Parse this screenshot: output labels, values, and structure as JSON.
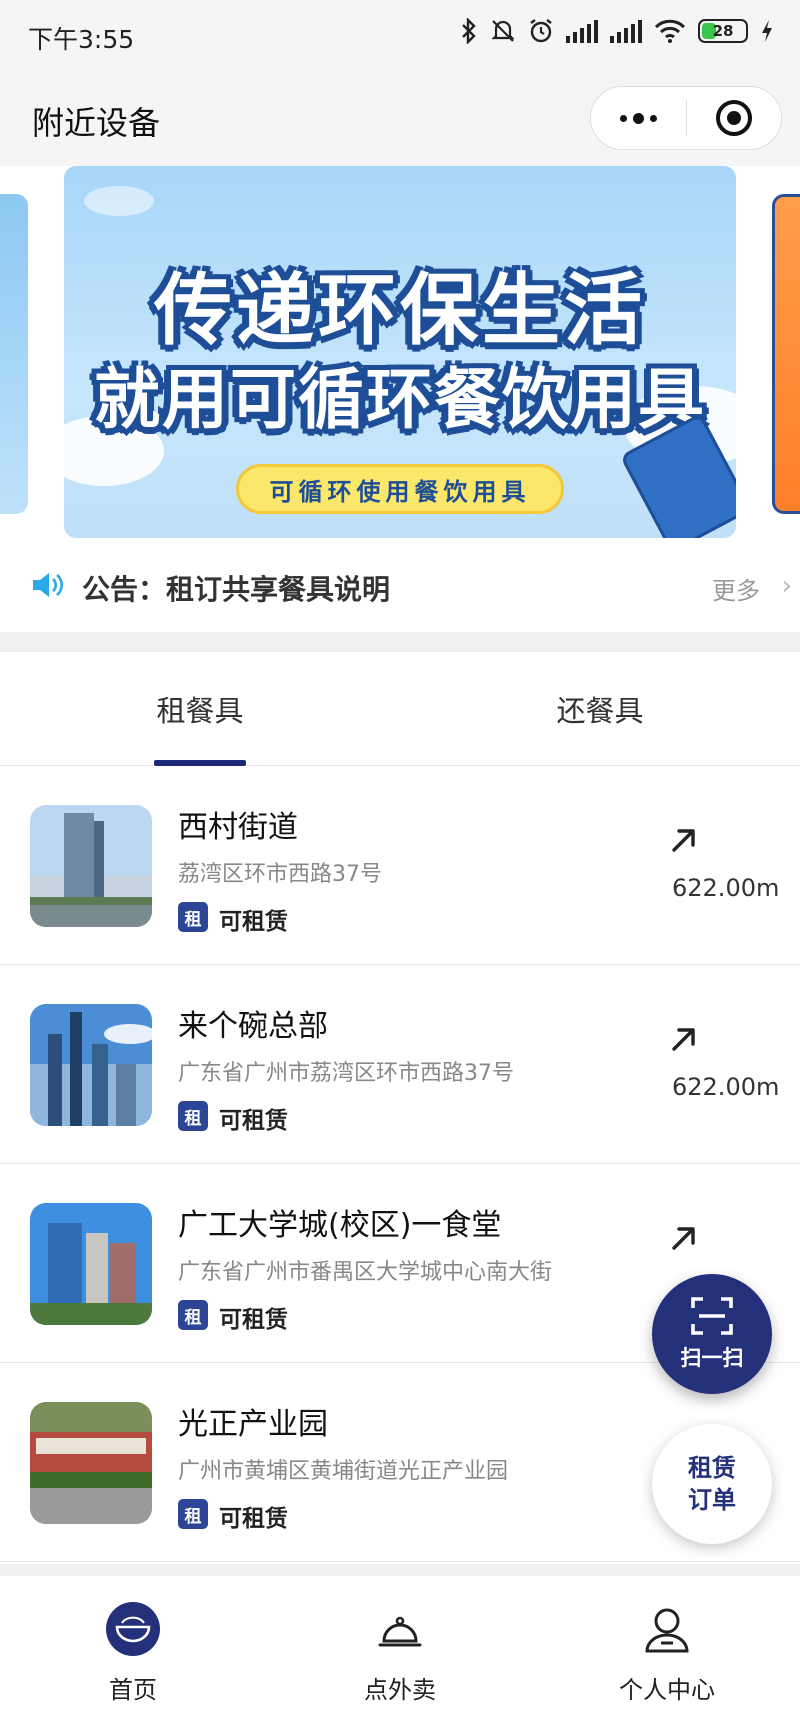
{
  "status_bar": {
    "time": "下午3:55",
    "battery": "28"
  },
  "header": {
    "title": "附近设备"
  },
  "banner": {
    "line1": "传递环保生活",
    "line2": "就用可循环餐饮用具",
    "pill": "可循环使用餐饮用具"
  },
  "notice": {
    "text": "公告：租订共享餐具说明",
    "more": "更多"
  },
  "tabs": [
    {
      "label": "租餐具",
      "active": true
    },
    {
      "label": "还餐具",
      "active": false
    }
  ],
  "locations": [
    {
      "name": "西村街道",
      "address": "荔湾区环市西路37号",
      "badge": "租",
      "status": "可租赁",
      "distance": "622.00m"
    },
    {
      "name": "来个碗总部",
      "address": "广东省广州市荔湾区环市西路37号",
      "badge": "租",
      "status": "可租赁",
      "distance": "622.00m"
    },
    {
      "name": "广工大学城(校区)一食堂",
      "address": "广东省广州市番禺区大学城中心南大街",
      "badge": "租",
      "status": "可租赁",
      "distance": ""
    },
    {
      "name": "光正产业园",
      "address": "广州市黄埔区黄埔街道光正产业园",
      "badge": "租",
      "status": "可租赁",
      "distance": ""
    }
  ],
  "fab": {
    "scan_label": "扫一扫",
    "order_label": "租赁订单"
  },
  "bottom_nav": [
    {
      "label": "首页",
      "icon": "home-logo-icon",
      "active": true
    },
    {
      "label": "点外卖",
      "icon": "bell-icon",
      "active": false
    },
    {
      "label": "个人中心",
      "icon": "user-icon",
      "active": false
    }
  ],
  "colors": {
    "accent": "#1e2a78",
    "badge": "#2c4596",
    "banner_text_outline": "#1d4e97",
    "banner_pill": "#fbe86a"
  }
}
